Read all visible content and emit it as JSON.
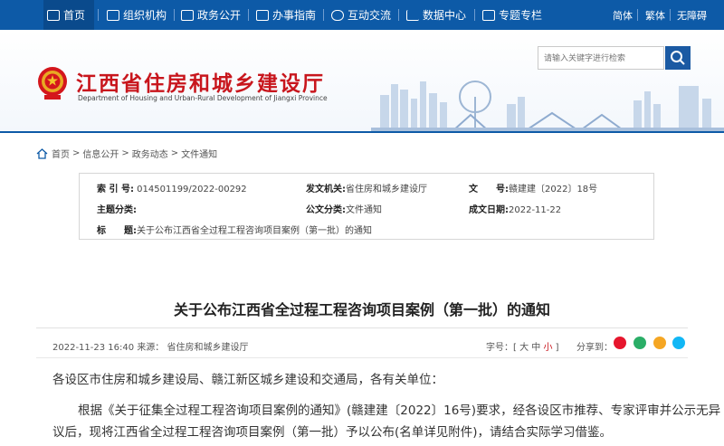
{
  "topnav": {
    "items": [
      {
        "label": "首页",
        "icon": "home-icon"
      },
      {
        "label": "组织机构",
        "icon": "org-icon"
      },
      {
        "label": "政务公开",
        "icon": "document-icon"
      },
      {
        "label": "办事指南",
        "icon": "guide-icon"
      },
      {
        "label": "互动交流",
        "icon": "chat-icon"
      },
      {
        "label": "数据中心",
        "icon": "chart-icon"
      },
      {
        "label": "专题专栏",
        "icon": "folder-icon"
      }
    ],
    "lang": {
      "simplified": "简体",
      "traditional": "繁体",
      "accessibility": "无障碍"
    }
  },
  "header": {
    "title": "江西省住房和城乡建设厅",
    "subtitle": "Department of Housing and Urban-Rural Development of Jiangxi Province",
    "search_placeholder": "请输入关键字进行检索"
  },
  "breadcrumb": {
    "items": [
      "首页",
      "信息公开",
      "政务动态",
      "文件通知"
    ],
    "sep": ">"
  },
  "meta": {
    "index_label": "索 引 号:",
    "index_value": "014501199/2022-00292",
    "issuer_label": "发文机关:",
    "issuer_value": "省住房和城乡建设厅",
    "docno_label": "文　　号:",
    "docno_value": "赣建建〔2022〕18号",
    "topic_label": "主题分类:",
    "topic_value": "",
    "category_label": "公文分类:",
    "category_value": "文件通知",
    "date_label": "成文日期:",
    "date_value": "2022-11-22",
    "title_label": "标　　题:",
    "title_value": "关于公布江西省全过程工程咨询项目案例（第一批）的通知"
  },
  "article": {
    "title": "关于公布江西省全过程工程咨询项目案例（第一批）的通知",
    "datetime": "2022-11-23 16:40",
    "source": "来源：  省住房和城乡建设厅",
    "fontsize_label": "字号：",
    "font_big": "大",
    "font_mid": "中",
    "font_small": "小",
    "share_label": "分享到：",
    "salutation": "各设区市住房和城乡建设局、赣江新区城乡建设和交通局，各有关单位：",
    "body_line1": "根据《关于征集全过程工程咨询项目案例的通知》(赣建建〔2022〕16号)要求，经各设区市推荐、专家评审并公示无异",
    "body_line2": "议后，现将江西省全过程工程咨询项目案例（第一批）予以公布(名单详见附件)，请结合实际学习借鉴。"
  },
  "colors": {
    "primary": "#0d5aa7",
    "title_red": "#c8161d"
  }
}
